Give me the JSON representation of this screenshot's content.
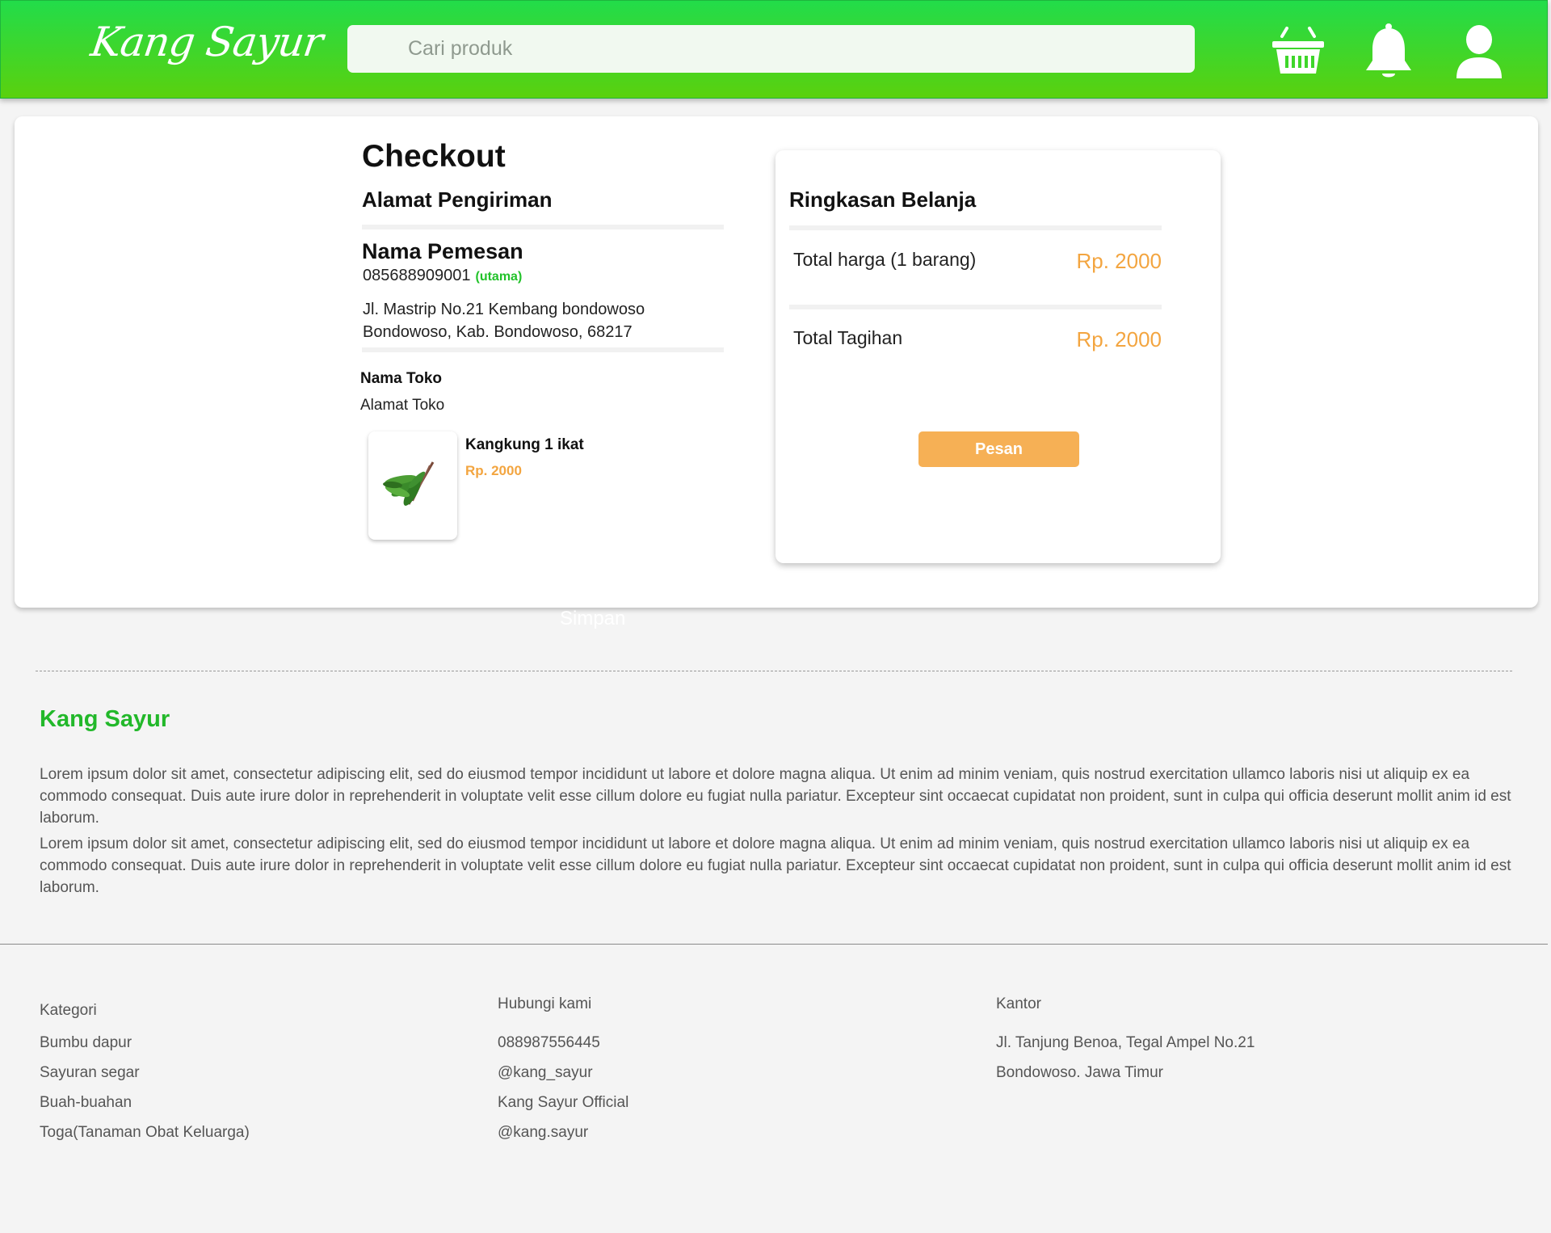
{
  "header": {
    "logo": "Kang Sayur",
    "search_placeholder": "Cari produk",
    "icons": [
      "basket-icon",
      "bell-icon",
      "user-icon"
    ]
  },
  "checkout": {
    "title": "Checkout",
    "shipping_heading": "Alamat Pengiriman",
    "buyer_name": "Nama Pemesan",
    "phone": "085688909001",
    "phone_tag": "(utama)",
    "address_line1": "Jl. Mastrip No.21 Kembang bondowoso",
    "address_line2": "Bondowoso, Kab. Bondowoso, 68217",
    "store_name": "Nama Toko",
    "store_address": "Alamat Toko",
    "product": {
      "name": "Kangkung 1 ikat",
      "price": "Rp. 2000"
    }
  },
  "summary": {
    "title": "Ringkasan Belanja",
    "total_price_label": "Total harga (1 barang)",
    "total_price_value": "Rp. 2000",
    "total_bill_label": "Total Tagihan",
    "total_bill_value": "Rp. 2000",
    "order_button": "Pesan"
  },
  "save_label": "Simpan",
  "about": {
    "brand": "Kang Sayur",
    "paragraph1": "Lorem ipsum dolor sit amet, consectetur adipiscing elit, sed do eiusmod tempor incididunt ut labore et dolore magna aliqua. Ut enim ad minim veniam, quis nostrud exercitation ullamco laboris nisi ut aliquip ex ea commodo consequat. Duis aute irure dolor in reprehenderit in voluptate velit esse cillum dolore eu fugiat nulla pariatur. Excepteur sint occaecat cupidatat non proident, sunt in culpa qui officia deserunt mollit anim id est laborum.",
    "paragraph2": "Lorem ipsum dolor sit amet, consectetur adipiscing elit, sed do eiusmod tempor incididunt ut labore et dolore magna aliqua. Ut enim ad minim veniam, quis nostrud exercitation ullamco laboris nisi ut aliquip ex ea commodo consequat. Duis aute irure dolor in reprehenderit in voluptate velit esse cillum dolore eu fugiat nulla pariatur. Excepteur sint occaecat cupidatat non proident, sunt in culpa qui officia deserunt mollit anim id est laborum."
  },
  "footer": {
    "kategori": {
      "title": "Kategori",
      "items": [
        "Bumbu dapur",
        "Sayuran segar",
        "Buah-buahan",
        "Toga(Tanaman Obat Keluarga)"
      ]
    },
    "hubungi": {
      "title": "Hubungi kami",
      "items": [
        "088987556445",
        "@kang_sayur",
        "Kang Sayur Official",
        "@kang.sayur"
      ]
    },
    "kantor": {
      "title": "Kantor",
      "items": [
        "Jl. Tanjung Benoa, Tegal Ampel No.21",
        "Bondowoso. Jawa Timur"
      ]
    }
  }
}
